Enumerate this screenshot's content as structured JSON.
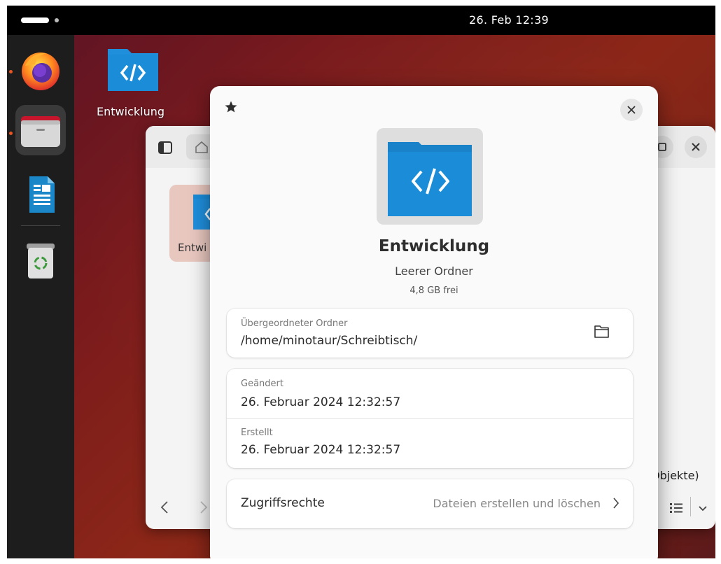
{
  "topbar": {
    "clock": "26. Feb  12:39"
  },
  "desktop": {
    "folder_label": "Entwicklung"
  },
  "file_manager": {
    "item_label": "Entwi",
    "status_text": "Objekte)"
  },
  "dialog": {
    "title": "Entwicklung",
    "subtitle": "Leerer Ordner",
    "free_space": "4,8 GB frei",
    "parent": {
      "caption": "Übergeordneter Ordner",
      "value": "/home/minotaur/Schreibtisch/"
    },
    "modified": {
      "caption": "Geändert",
      "value": "26. Februar 2024 12:32:57"
    },
    "created": {
      "caption": "Erstellt",
      "value": "26. Februar 2024 12:32:57"
    },
    "permissions": {
      "label": "Zugriffsrechte",
      "value": "Dateien erstellen und löschen"
    }
  },
  "colors": {
    "accent": "#e95420",
    "folder_blue": "#1a8cd8"
  }
}
